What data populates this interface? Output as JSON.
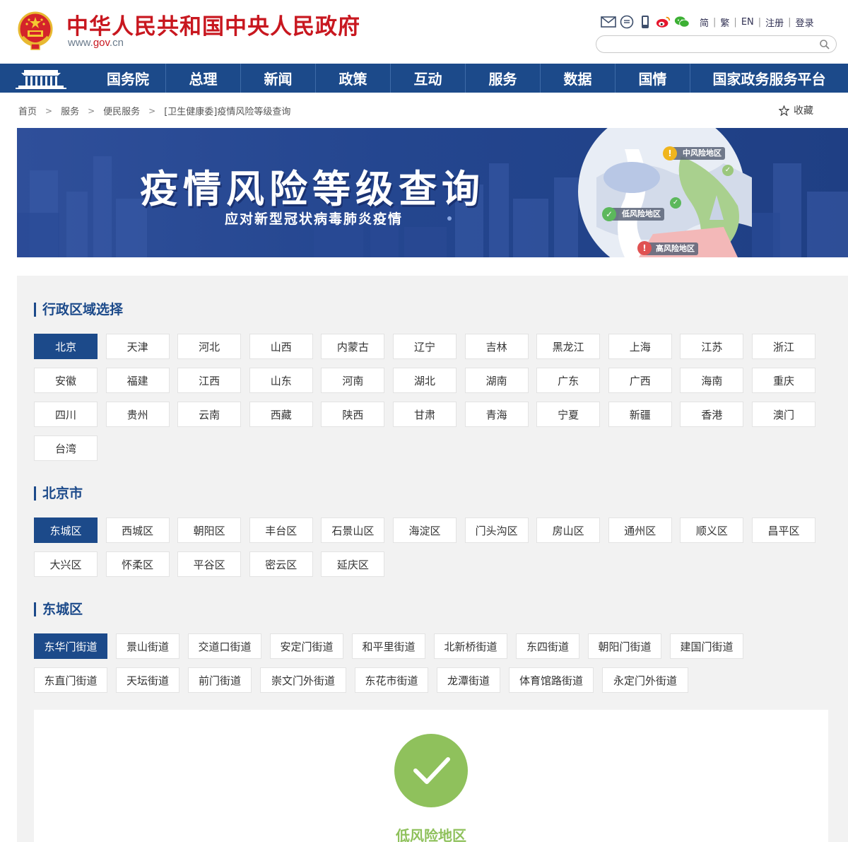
{
  "header": {
    "site_title": "中华人民共和国中央人民政府",
    "site_url_prefix": "www.",
    "site_url_gov": "gov",
    "site_url_suffix": ".cn",
    "tool_icons": [
      "mail-icon",
      "message-icon",
      "mobile-icon",
      "weibo-icon",
      "wechat-icon"
    ],
    "links": [
      "简",
      "繁",
      "EN",
      "注册",
      "登录"
    ],
    "search_placeholder": ""
  },
  "nav": {
    "items": [
      "国务院",
      "总理",
      "新闻",
      "政策",
      "互动",
      "服务",
      "数据",
      "国情",
      "国家政务服务平台"
    ]
  },
  "breadcrumb": {
    "items": [
      "首页",
      "服务",
      "便民服务",
      "[卫生健康委]疫情风险等级查询"
    ],
    "favorite": "收藏"
  },
  "banner": {
    "title": "疫情风险等级查询",
    "subtitle": "应对新型冠状病毒肺炎疫情",
    "tags": {
      "medium": "中风险地区",
      "low": "低风险地区",
      "high": "高风险地区"
    }
  },
  "sections": {
    "region": {
      "title": "行政区域选择",
      "items": [
        "北京",
        "天津",
        "河北",
        "山西",
        "内蒙古",
        "辽宁",
        "吉林",
        "黑龙江",
        "上海",
        "江苏",
        "浙江",
        "安徽",
        "福建",
        "江西",
        "山东",
        "河南",
        "湖北",
        "湖南",
        "广东",
        "广西",
        "海南",
        "重庆",
        "四川",
        "贵州",
        "云南",
        "西藏",
        "陕西",
        "甘肃",
        "青海",
        "宁夏",
        "新疆",
        "香港",
        "澳门",
        "台湾"
      ],
      "selected": "北京"
    },
    "city": {
      "title": "北京市",
      "items": [
        "东城区",
        "西城区",
        "朝阳区",
        "丰台区",
        "石景山区",
        "海淀区",
        "门头沟区",
        "房山区",
        "通州区",
        "顺义区",
        "昌平区",
        "大兴区",
        "怀柔区",
        "平谷区",
        "密云区",
        "延庆区"
      ],
      "selected": "东城区"
    },
    "district": {
      "title": "东城区",
      "items": [
        "东华门街道",
        "景山街道",
        "交道口街道",
        "安定门街道",
        "和平里街道",
        "北新桥街道",
        "东四街道",
        "朝阳门街道",
        "建国门街道",
        "东直门街道",
        "天坛街道",
        "前门街道",
        "崇文门外街道",
        "东花市街道",
        "龙潭街道",
        "体育馆路街道",
        "永定门外街道"
      ],
      "selected": "东华门街道"
    }
  },
  "result": {
    "status": "低风险地区",
    "icon": "checkmark-icon"
  },
  "colors": {
    "brand_red": "#c8171f",
    "nav_blue": "#1c4a8a",
    "low_risk_green": "#8fc15c",
    "medium_risk_yellow": "#f0b51e",
    "high_risk_red": "#e05252"
  }
}
